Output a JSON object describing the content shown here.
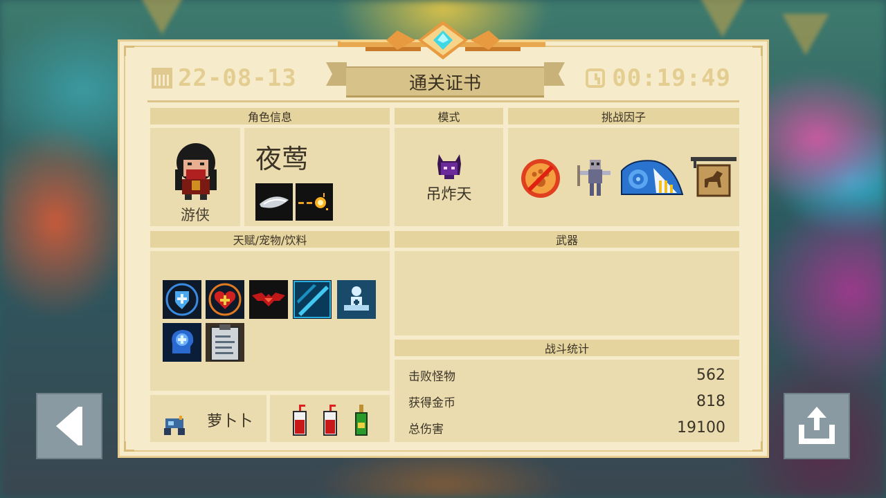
{
  "certificate": {
    "title": "通关证书",
    "date": "22-08-13",
    "time": "00:19:49"
  },
  "sections": {
    "character_header": "角色信息",
    "mode_header": "模式",
    "challenge_header": "挑战因子",
    "talents_header": "天赋/宠物/饮料",
    "weapons_header": "武器",
    "stats_header": "战斗统计"
  },
  "character": {
    "class": "游侠",
    "skin_name": "夜莺"
  },
  "mode": {
    "name": "吊炸天"
  },
  "pet": {
    "name": "萝卜卜"
  },
  "stats": [
    {
      "label": "击败怪物",
      "value": "562"
    },
    {
      "label": "获得金币",
      "value": "818"
    },
    {
      "label": "总伤害",
      "value": "19100"
    }
  ],
  "colors": {
    "panel_bg": "#f6eccc",
    "card_bg": "#ebdcb0",
    "header_bg": "#e6d49e",
    "accent_gold": "#e3cd91",
    "gem": "#3fd6e6"
  },
  "icons": {
    "skills": [
      "slash-skill-icon",
      "bullet-skill-icon"
    ],
    "challenges": [
      "no-paw-icon",
      "skeleton-warrior-icon",
      "blue-shell-icon",
      "horse-sign-icon"
    ],
    "talents": [
      "shield-talent-icon",
      "heart-talent-icon",
      "bat-wings-talent-icon",
      "blue-slash-talent-icon",
      "meditation-talent-icon",
      "brain-talent-icon",
      "clipboard-talent-icon"
    ],
    "drinks": [
      "red-drink-icon",
      "red-drink-icon",
      "green-bottle-icon"
    ]
  }
}
